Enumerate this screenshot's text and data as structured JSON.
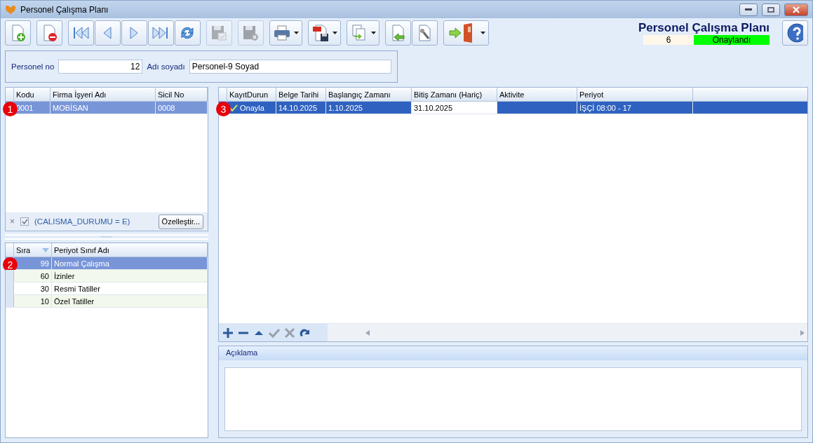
{
  "window": {
    "title": "Personel Çalışma Planı"
  },
  "toolbar": [
    [
      {
        "kind": "new",
        "disabled": false,
        "dropdown": false
      }
    ],
    [
      {
        "kind": "delete",
        "disabled": false,
        "dropdown": false
      }
    ],
    [
      {
        "kind": "first",
        "disabled": false,
        "dropdown": false
      },
      {
        "kind": "prev",
        "disabled": false,
        "dropdown": false
      },
      {
        "kind": "next",
        "disabled": false,
        "dropdown": false
      },
      {
        "kind": "last",
        "disabled": false,
        "dropdown": false
      },
      {
        "kind": "refresh",
        "disabled": false,
        "dropdown": false
      }
    ],
    [
      {
        "kind": "save",
        "disabled": true,
        "dropdown": false
      }
    ],
    [
      {
        "kind": "cancel",
        "disabled": true,
        "dropdown": false
      }
    ],
    [
      {
        "kind": "print",
        "disabled": false,
        "dropdown": true
      }
    ],
    [
      {
        "kind": "pdf",
        "disabled": false,
        "dropdown": true
      }
    ],
    [
      {
        "kind": "export",
        "disabled": false,
        "dropdown": true
      }
    ],
    [
      {
        "kind": "import",
        "disabled": false,
        "dropdown": false
      },
      {
        "kind": "tools",
        "disabled": false,
        "dropdown": false
      }
    ],
    [
      {
        "kind": "exit",
        "disabled": false,
        "dropdown": true
      }
    ]
  ],
  "header": {
    "title": "Personel Çalışma Planı",
    "number": "6",
    "status": "Onaylandı"
  },
  "person": {
    "no_label": "Personel no",
    "no_value": "12",
    "name_label": "Adı soyadı",
    "name_value": "Personel-9 Soyad"
  },
  "company_grid": {
    "columns": [
      "Kodu",
      "Firma İşyeri Adı",
      "Sicil No"
    ],
    "rows": [
      {
        "cells": [
          "0001",
          "MOBİSAN",
          "0008"
        ],
        "selected": true,
        "marker": "1"
      }
    ],
    "filter": {
      "text": "(CALISMA_DURUMU = E)",
      "checked": true,
      "clear": "×",
      "button": "Özelleştir..."
    }
  },
  "period_grid": {
    "columns": [
      "Sıra",
      "Periyot Sınıf Adı"
    ],
    "rows": [
      {
        "cells": [
          "99",
          "Normal Çalışma"
        ],
        "selected": true,
        "marker": "2"
      },
      {
        "cells": [
          "60",
          "İzinler"
        ],
        "selected": false
      },
      {
        "cells": [
          "30",
          "Resmi Tatiller"
        ],
        "selected": false
      },
      {
        "cells": [
          "10",
          "Özel Tatiller"
        ],
        "selected": false
      }
    ]
  },
  "plan_grid": {
    "columns": [
      "KayıtDurun",
      "Belge Tarihi",
      "Başlangıç Zamanı",
      "Bitiş Zamanı (Hariç)",
      "Aktivite",
      "Periyot"
    ],
    "rows": [
      {
        "cells": [
          {
            "text": "Onayla",
            "focused": false
          },
          {
            "text": "14.10.2025",
            "focused": false
          },
          {
            "text": "1.10.2025",
            "focused": false
          },
          {
            "text": "31.10.2025",
            "focused": true
          },
          {
            "text": "",
            "focused": false
          },
          {
            "text": "İŞÇİ 08:00 - 17",
            "focused": false
          }
        ],
        "selected": true,
        "approved": true,
        "marker": "3"
      }
    ],
    "navigator": [
      {
        "kind": "add",
        "disabled": false
      },
      {
        "kind": "remove",
        "disabled": false
      },
      {
        "kind": "up",
        "disabled": false
      },
      {
        "kind": "confirm",
        "disabled": true
      },
      {
        "kind": "discard",
        "disabled": true
      },
      {
        "kind": "redo",
        "disabled": false
      }
    ]
  },
  "note": {
    "title": "Açıklama"
  }
}
